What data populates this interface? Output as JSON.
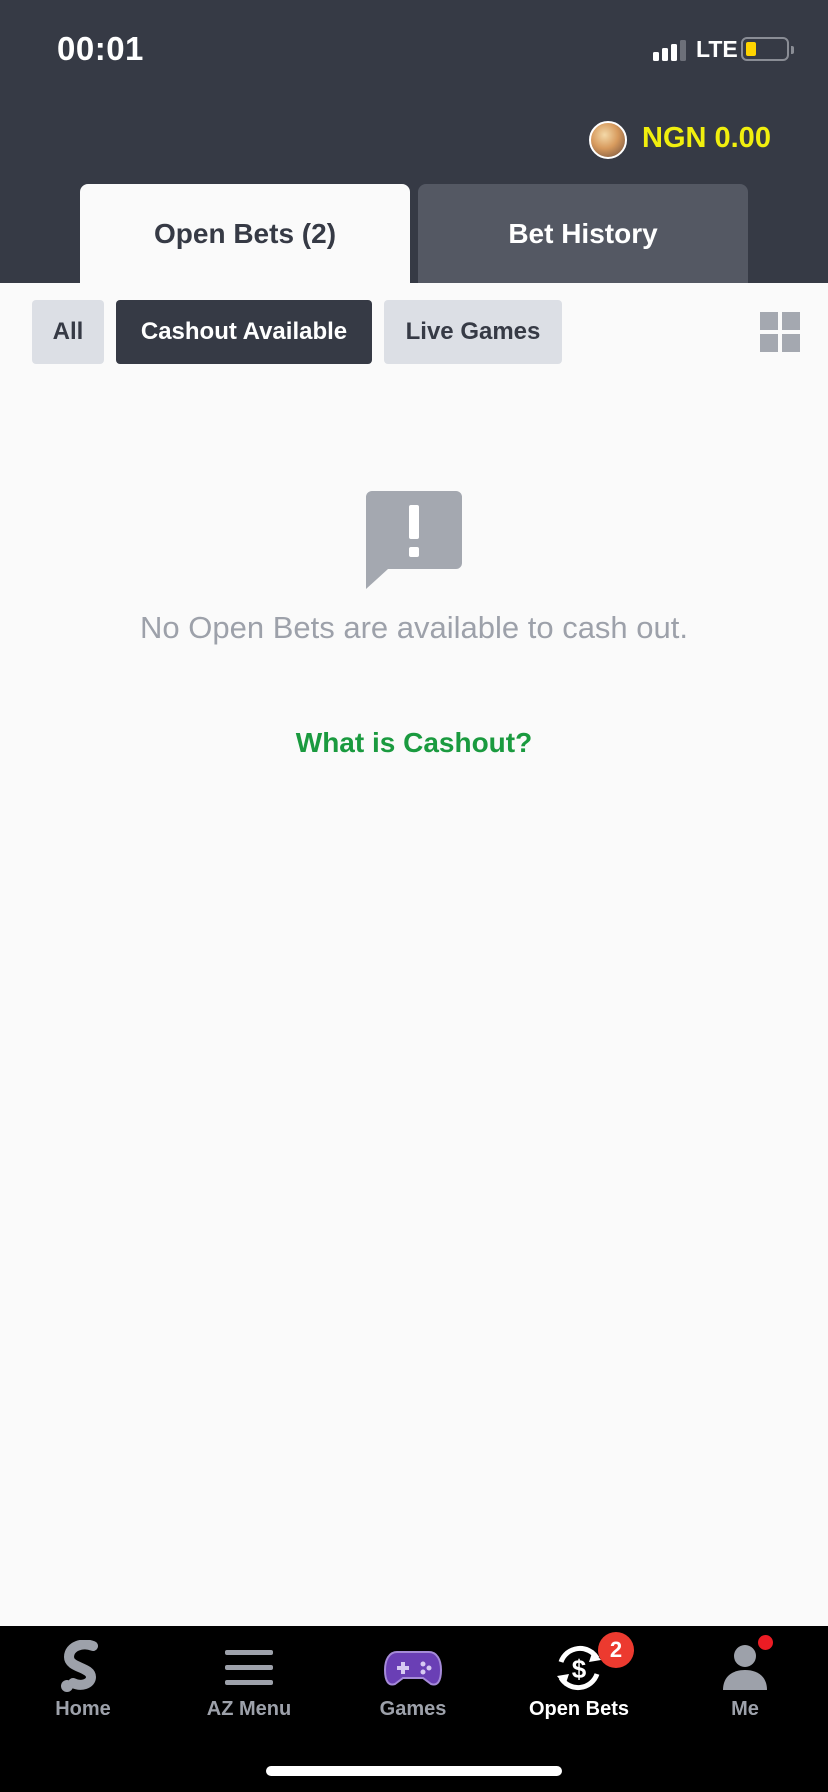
{
  "status_bar": {
    "time": "00:01",
    "network": "LTE"
  },
  "header": {
    "balance": "NGN 0.00"
  },
  "tabs": [
    {
      "label": "Open Bets (2)",
      "active": true
    },
    {
      "label": "Bet History",
      "active": false
    }
  ],
  "filters": [
    {
      "label": "All",
      "selected": false
    },
    {
      "label": "Cashout Available",
      "selected": true
    },
    {
      "label": "Live Games",
      "selected": false
    }
  ],
  "empty_state": {
    "message": "No Open Bets are available to cash out.",
    "link_label": "What is Cashout?"
  },
  "bottom_nav": [
    {
      "label": "Home",
      "icon": "sportybet-logo-icon",
      "active": false
    },
    {
      "label": "AZ Menu",
      "icon": "menu-icon",
      "active": false
    },
    {
      "label": "Games",
      "icon": "gamepad-icon",
      "active": false
    },
    {
      "label": "Open Bets",
      "icon": "cashout-icon",
      "active": true,
      "badge": "2"
    },
    {
      "label": "Me",
      "icon": "person-icon",
      "active": false
    }
  ],
  "colors": {
    "header_bg": "#363a45",
    "balance": "#f1ef0e",
    "link_green": "#1a9a3f",
    "badge_red": "#ec3a2f"
  }
}
